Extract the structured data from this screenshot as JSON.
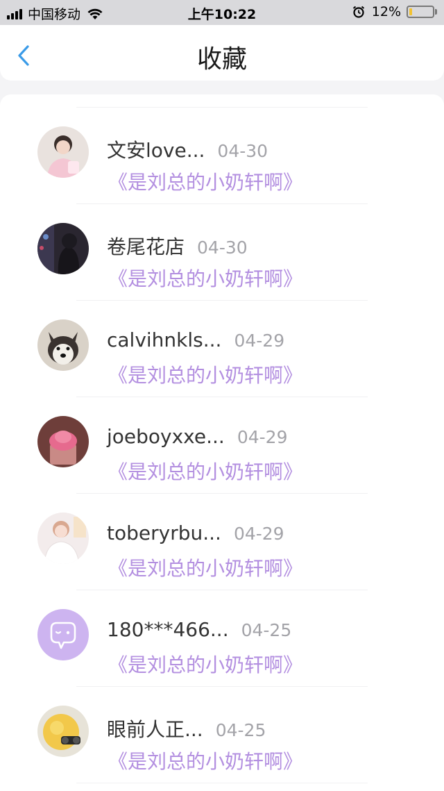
{
  "status_bar": {
    "carrier": "中国移动",
    "time": "上午10:22",
    "battery_percent": "12%",
    "battery_level": 0.12,
    "icons": [
      "signal-icon",
      "wifi-icon",
      "alarm-icon",
      "battery-icon"
    ]
  },
  "nav": {
    "back_icon": "chevron-left-icon",
    "title": "收藏",
    "accent_color": "#3a9be8"
  },
  "colors": {
    "title_purple": "#b38fe0",
    "date_gray": "#a3a3a8",
    "avatar_lavender": "#cdb4f0"
  },
  "items": [
    {
      "name": "文安love...",
      "date": "04-30",
      "title": "《是刘总的小奶轩啊》",
      "avatar": "photo-portrait-pink"
    },
    {
      "name": "卷尾花店",
      "date": "04-30",
      "title": "《是刘总的小奶轩啊》",
      "avatar": "photo-dark-room"
    },
    {
      "name": "calvihnkls...",
      "date": "04-29",
      "title": "《是刘总的小奶轩啊》",
      "avatar": "photo-husky-dog"
    },
    {
      "name": "joeboyxxe...",
      "date": "04-29",
      "title": "《是刘总的小奶轩啊》",
      "avatar": "photo-cupcake"
    },
    {
      "name": "toberyrbu...",
      "date": "04-29",
      "title": "《是刘总的小奶轩啊》",
      "avatar": "photo-girl-white"
    },
    {
      "name": "180***466...",
      "date": "04-25",
      "title": "《是刘总的小奶轩啊》",
      "avatar": "default-chat-bubble-icon"
    },
    {
      "name": "眼前人正...",
      "date": "04-25",
      "title": "《是刘总的小奶轩啊》",
      "avatar": "photo-yellow-toy"
    }
  ]
}
